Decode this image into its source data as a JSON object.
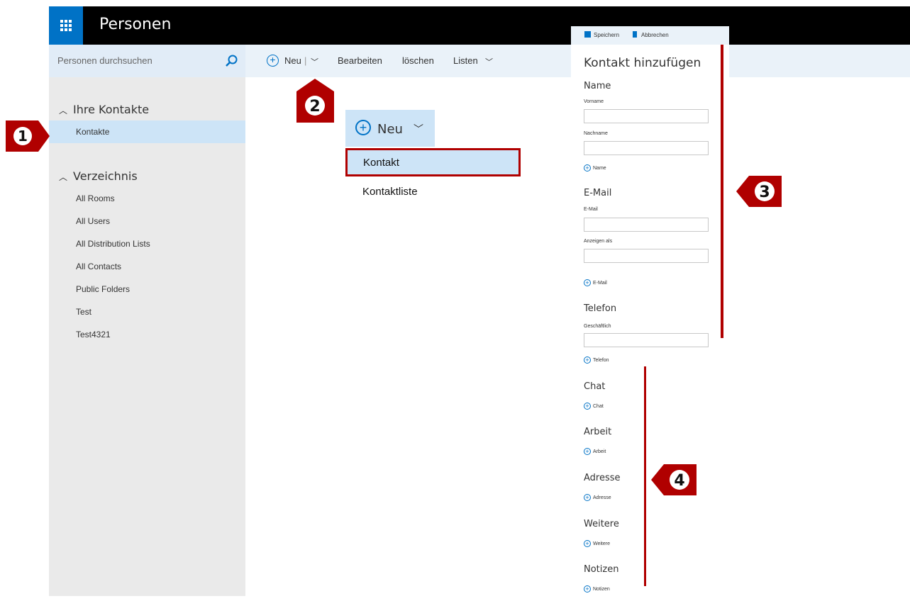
{
  "app": {
    "title": "Personen"
  },
  "search": {
    "placeholder": "Personen durchsuchen"
  },
  "nav": {
    "section1": {
      "label": "Ihre Kontakte",
      "items": [
        "Kontakte"
      ]
    },
    "section2": {
      "label": "Verzeichnis",
      "items": [
        "All Rooms",
        "All Users",
        "All Distribution Lists",
        "All Contacts",
        "Public Folders",
        "Test",
        "Test4321"
      ]
    }
  },
  "toolbar": {
    "new": "Neu",
    "edit": "Bearbeiten",
    "delete": "löschen",
    "lists": "Listen"
  },
  "dropdown": {
    "new": "Neu",
    "items": [
      "Kontakt",
      "Kontaktliste"
    ]
  },
  "form": {
    "save": "Speichern",
    "cancel": "Abbrechen",
    "title": "Kontakt hinzufügen",
    "sections": {
      "name": {
        "title": "Name",
        "fields": [
          "Vorname",
          "Nachname"
        ],
        "add": "Name"
      },
      "email": {
        "title": "E-Mail",
        "fields": [
          "E-Mail",
          "Anzeigen als"
        ],
        "add": "E-Mail"
      },
      "phone": {
        "title": "Telefon",
        "fields": [
          "Geschäftlich"
        ],
        "add": "Telefon"
      },
      "chat": {
        "title": "Chat",
        "add": "Chat"
      },
      "work": {
        "title": "Arbeit",
        "add": "Arbeit"
      },
      "address": {
        "title": "Adresse",
        "add": "Adresse"
      },
      "more": {
        "title": "Weitere",
        "add": "Weitere"
      },
      "notes": {
        "title": "Notizen",
        "add": "Notizen"
      }
    }
  },
  "callouts": [
    "1",
    "2",
    "3",
    "4"
  ],
  "colors": {
    "accent": "#0072c6",
    "annotation": "#b00000",
    "selected": "#cde4f7"
  }
}
